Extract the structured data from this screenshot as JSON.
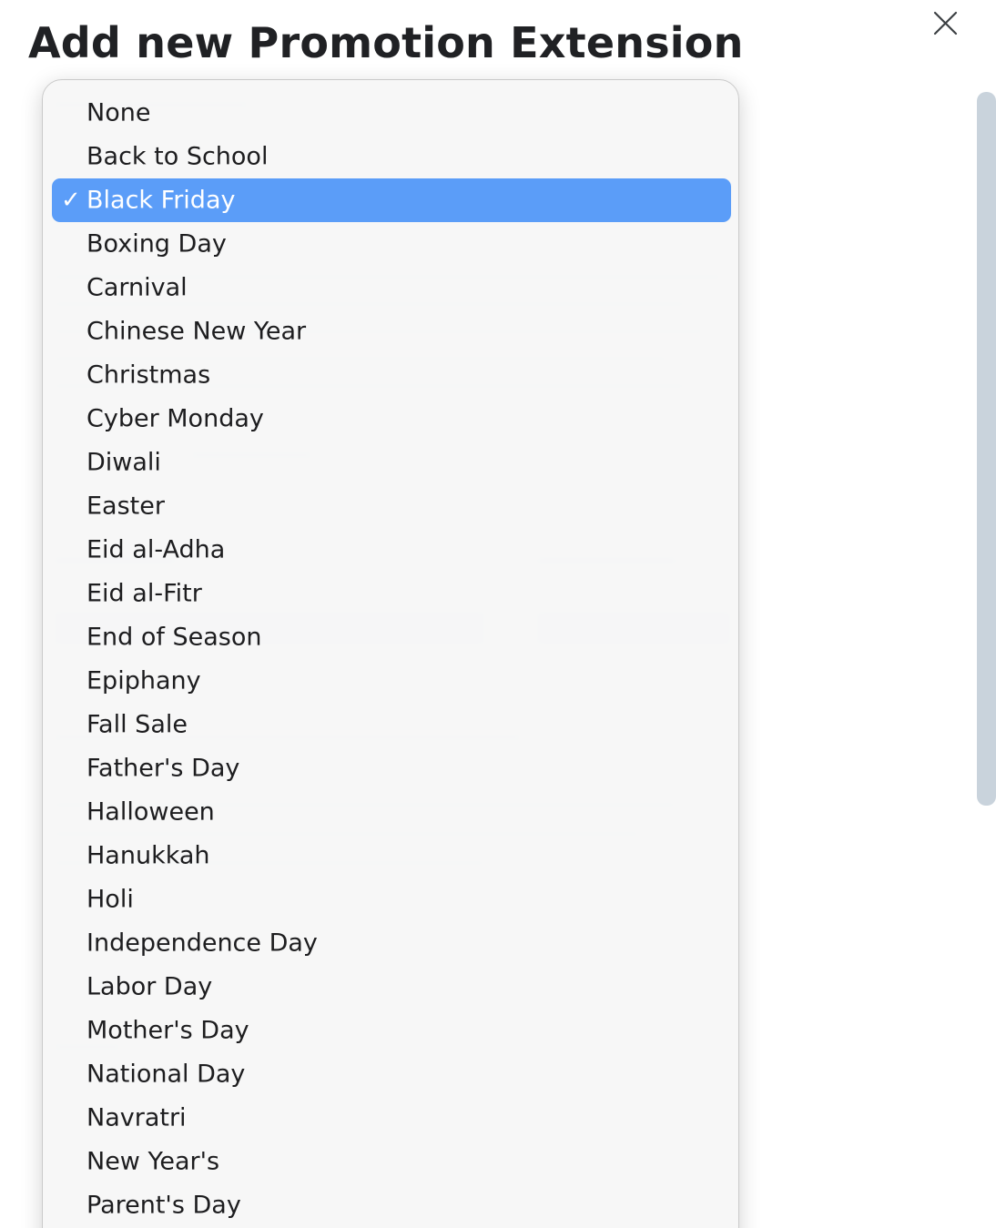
{
  "dialog": {
    "title": "Add new Promotion Extension",
    "close_icon": "close-icon"
  },
  "dropdown": {
    "selected_index": 2,
    "check_glyph": "✓",
    "accent_color": "#5b9df8",
    "options": [
      "None",
      "Back to School",
      "Black Friday",
      "Boxing Day",
      "Carnival",
      "Chinese New Year",
      "Christmas",
      "Cyber Monday",
      "Diwali",
      "Easter",
      "Eid al-Adha",
      "Eid al-Fitr",
      "End of Season",
      "Epiphany",
      "Fall Sale",
      "Father's Day",
      "Halloween",
      "Hanukkah",
      "Holi",
      "Independence Day",
      "Labor Day",
      "Mother's Day",
      "National Day",
      "Navratri",
      "New Year's",
      "Parent's Day"
    ]
  }
}
